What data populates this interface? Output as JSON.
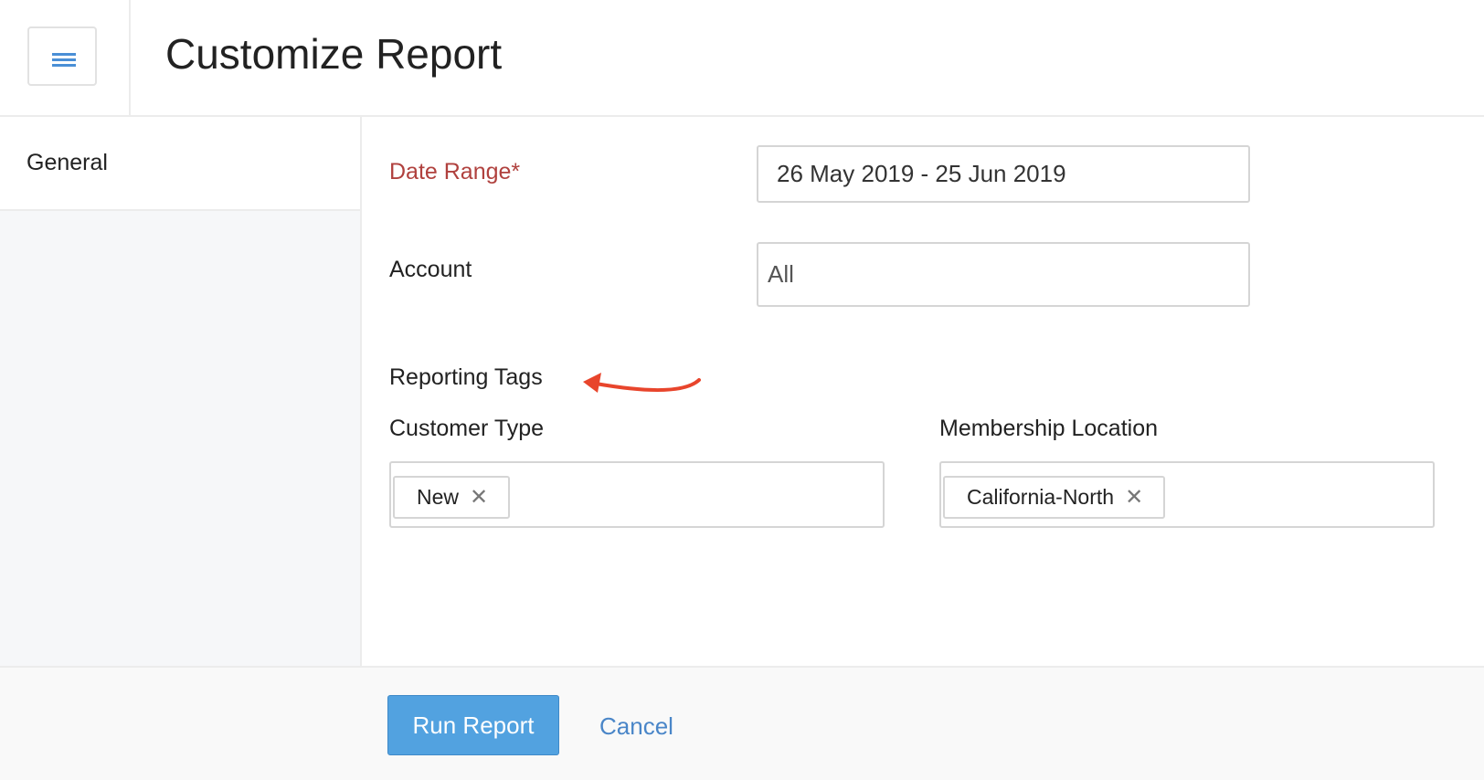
{
  "header": {
    "title": "Customize Report",
    "menu_icon": "hamburger-icon"
  },
  "sidebar": {
    "items": [
      {
        "label": "General"
      }
    ]
  },
  "form": {
    "date_range": {
      "label": "Date Range*",
      "value": "26 May 2019 - 25 Jun 2019"
    },
    "account": {
      "label": "Account",
      "value": "All"
    },
    "reporting_tags": {
      "label": "Reporting Tags"
    },
    "customer_type": {
      "label": "Customer Type",
      "tags": [
        "New"
      ]
    },
    "membership_location": {
      "label": "Membership Location",
      "tags": [
        "California-North"
      ]
    }
  },
  "footer": {
    "run_label": "Run Report",
    "cancel_label": "Cancel"
  },
  "colors": {
    "accent": "#52a2e0",
    "required": "#b0413e",
    "annotation_arrow": "#e8452c"
  }
}
